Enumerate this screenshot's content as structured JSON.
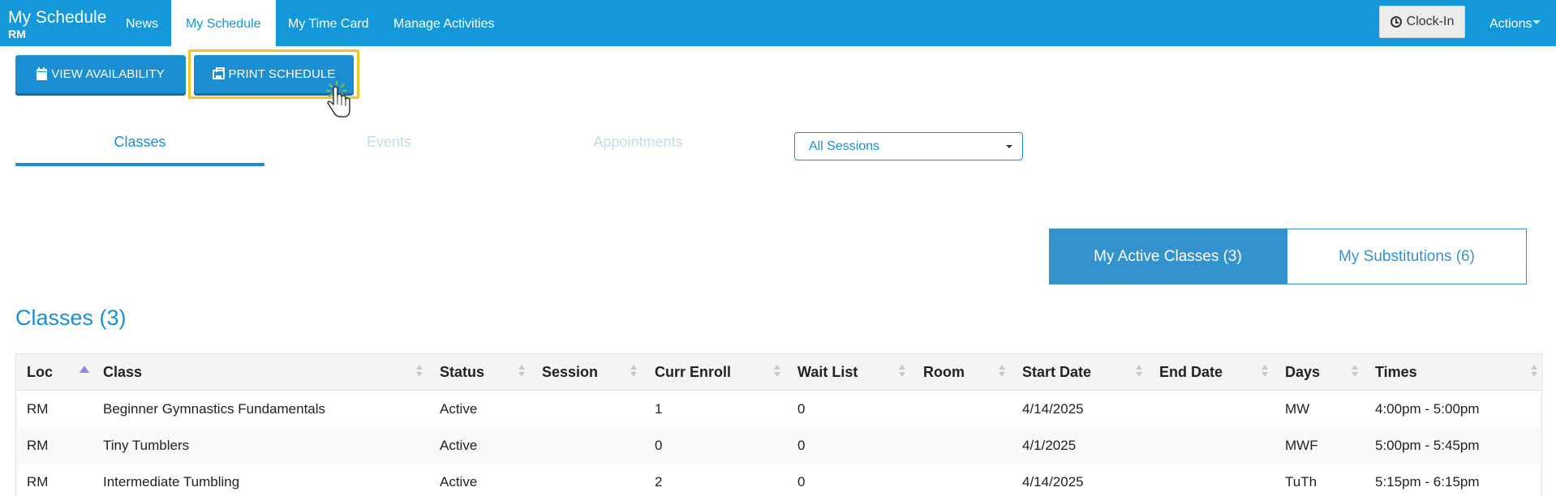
{
  "nav": {
    "brand_title": "My Schedule",
    "brand_subtitle": "RM",
    "items": [
      {
        "label": "News",
        "active": false
      },
      {
        "label": "My Schedule",
        "active": true
      },
      {
        "label": "My Time Card",
        "active": false
      },
      {
        "label": "Manage Activities",
        "active": false
      }
    ],
    "clock_in_label": "Clock-In",
    "actions_label": "Actions"
  },
  "toolbar": {
    "view_availability_label": "VIEW AVAILABILITY",
    "print_schedule_label": "PRINT SCHEDULE"
  },
  "tabs": [
    {
      "label": "Classes",
      "active": true
    },
    {
      "label": "Events",
      "active": false
    },
    {
      "label": "Appointments",
      "active": false
    }
  ],
  "session_select": {
    "selected": "All Sessions"
  },
  "toggle": {
    "active_label": "My Active Classes (3)",
    "substitutions_label": "My Substitutions (6)"
  },
  "section_title": "Classes (3)",
  "table": {
    "columns": [
      "Loc",
      "Class",
      "Status",
      "Session",
      "Curr Enroll",
      "Wait List",
      "Room",
      "Start Date",
      "End Date",
      "Days",
      "Times"
    ],
    "rows": [
      [
        "RM",
        "Beginner Gymnastics Fundamentals",
        "Active",
        "",
        "1",
        "0",
        "",
        "4/14/2025",
        "",
        "MW",
        "4:00pm - 5:00pm"
      ],
      [
        "RM",
        "Tiny Tumblers",
        "Active",
        "",
        "0",
        "0",
        "",
        "4/1/2025",
        "",
        "MWF",
        "5:00pm - 5:45pm"
      ],
      [
        "RM",
        "Intermediate Tumbling",
        "Active",
        "",
        "2",
        "0",
        "",
        "4/14/2025",
        "",
        "TuTh",
        "5:15pm - 6:15pm"
      ]
    ]
  },
  "colors": {
    "navbar": "#1498da",
    "primary": "#1b8fd2",
    "highlight": "#f4c22b",
    "toggle_active": "#3493cf"
  }
}
